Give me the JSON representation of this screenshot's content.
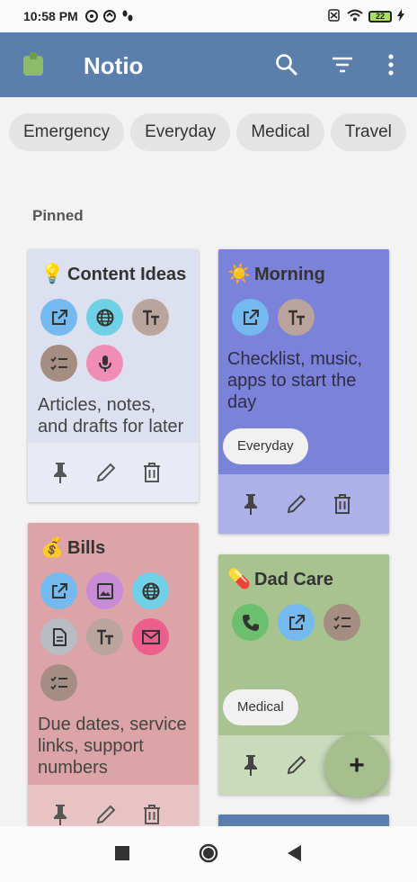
{
  "status_bar": {
    "time": "10:58 PM",
    "battery": "22"
  },
  "app_bar": {
    "title": "Notio",
    "colors": {
      "background": "#5b7fad",
      "logo": "#8dbb6a"
    }
  },
  "chips": [
    "Emergency",
    "Everyday",
    "Medical",
    "Travel"
  ],
  "pinned_label": "Pinned",
  "cards": {
    "content_ideas": {
      "emoji": "💡",
      "title": "Content Ideas",
      "description_lines": [
        "Articles, notes,",
        "and drafts for later"
      ],
      "icons": [
        "open-link-icon",
        "globe-icon",
        "text-icon",
        "checklist-icon",
        "microphone-icon"
      ],
      "color": "#dde0ee"
    },
    "morning": {
      "emoji": "☀️",
      "title": "Morning",
      "description_lines": [
        "Checklist, music,",
        "apps to start the",
        "day"
      ],
      "tag": "Everyday",
      "icons": [
        "open-link-icon",
        "text-icon"
      ],
      "color": "#7b82d9"
    },
    "bills": {
      "emoji": "💰",
      "title": "Bills",
      "description_lines": [
        "Due dates, service",
        "links, support",
        "numbers"
      ],
      "icons": [
        "open-link-icon",
        "image-icon",
        "globe-icon",
        "document-icon",
        "text-icon",
        "mail-icon",
        "checklist-icon"
      ],
      "color": "#dca4a6"
    },
    "dad_care": {
      "emoji": "💊",
      "title": "Dad Care",
      "tag": "Medical",
      "icons": [
        "phone-icon",
        "open-link-icon",
        "checklist-icon"
      ],
      "color": "#a7c490"
    }
  },
  "fab_label": "+"
}
